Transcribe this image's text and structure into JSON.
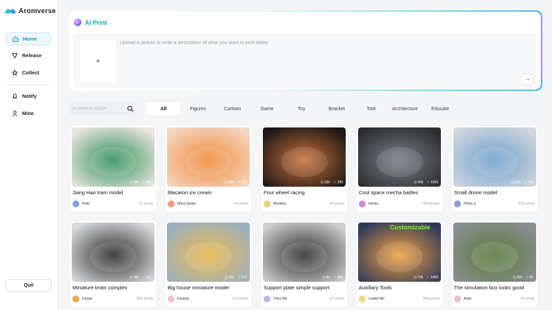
{
  "app": {
    "name": "Aromverse"
  },
  "nav": {
    "home": "Home",
    "release": "Release",
    "collect": "Collect",
    "notify": "Notify",
    "mine": "Mine",
    "quit": "Quit"
  },
  "ai_print": {
    "title": "AI Print",
    "upload_symbol": "+",
    "placeholder": "Upload a picture or write a description of what you want to print today",
    "send_symbol": "→"
  },
  "search": {
    "placeholder": "3D Modelle suchen"
  },
  "categories": [
    "All",
    "Figures",
    "Cartoon",
    "Game",
    "Toy",
    "Bracket",
    "Tool",
    "Architecture",
    "Educate"
  ],
  "models": [
    {
      "title": "Jiang Hao tram model",
      "author": "Brito",
      "prints": "12 prints",
      "time": "23h",
      "likes": "681",
      "avatar_color": "#7fa6e8",
      "thumb_colors": [
        "#e9e6df",
        "#2f8f5a"
      ]
    },
    {
      "title": "Macaron ice cream",
      "author": "Mina Hada",
      "prints": "74 prints",
      "time": "10h",
      "likes": "185",
      "avatar_color": "#e8a07f",
      "thumb_colors": [
        "#f4d7c2",
        "#f08a3a"
      ]
    },
    {
      "title": "Four wheel racing",
      "author": "Martina",
      "prints": "34 prints",
      "time": "12h",
      "likes": "290",
      "avatar_color": "#e8d27f",
      "thumb_colors": [
        "#1a1616",
        "#c9703a"
      ]
    },
    {
      "title": "Cool space mecha battles",
      "author": "Herko",
      "prints": "464 prints",
      "time": "46h",
      "likes": "1260",
      "avatar_color": "#c88fd8",
      "thumb_colors": [
        "#2a2c30",
        "#7a7e84"
      ]
    },
    {
      "title": "Small drone model",
      "author": "Phao a",
      "prints": "129 prints",
      "time": "62h",
      "likes": "160",
      "avatar_color": "#8f9ad8",
      "thumb_colors": [
        "#cfd6dd",
        "#6fa0cc"
      ]
    },
    {
      "title": "Miniature brain complex",
      "author": "Kinwe",
      "prints": "445 prints",
      "time": "16h",
      "likes": "157",
      "avatar_color": "#e8a85a",
      "thumb_colors": [
        "#d9dbdd",
        "#2a2a2a"
      ]
    },
    {
      "title": "Big house miniature model",
      "author": "Kisada",
      "prints": "124 prints",
      "time": "25h",
      "likes": "175",
      "avatar_color": "#f2c0c8",
      "thumb_colors": [
        "#9ab0c2",
        "#e9b84a"
      ]
    },
    {
      "title": "Support plate simple support",
      "author": "Tlina Bri",
      "prints": "37 prints",
      "time": "8h",
      "likes": "468",
      "avatar_color": "#c8b0e8",
      "thumb_colors": [
        "#cfcfcf",
        "#2d2d2d"
      ]
    },
    {
      "title": "Auxiliary Tools",
      "author": "Uadof Rlr",
      "prints": "564 prints",
      "time": "73h",
      "likes": "1460",
      "avatar_color": "#f0d88a",
      "thumb_colors": [
        "#2f3a5a",
        "#f0a040"
      ],
      "badge": "Customizable"
    },
    {
      "title": "The simulation box looks good",
      "author": "Arito",
      "prints": "78 prints",
      "time": "25h",
      "likes": "60",
      "avatar_color": "#e8c0d8",
      "thumb_colors": [
        "#8a8f93",
        "#5a7a3a"
      ]
    }
  ]
}
